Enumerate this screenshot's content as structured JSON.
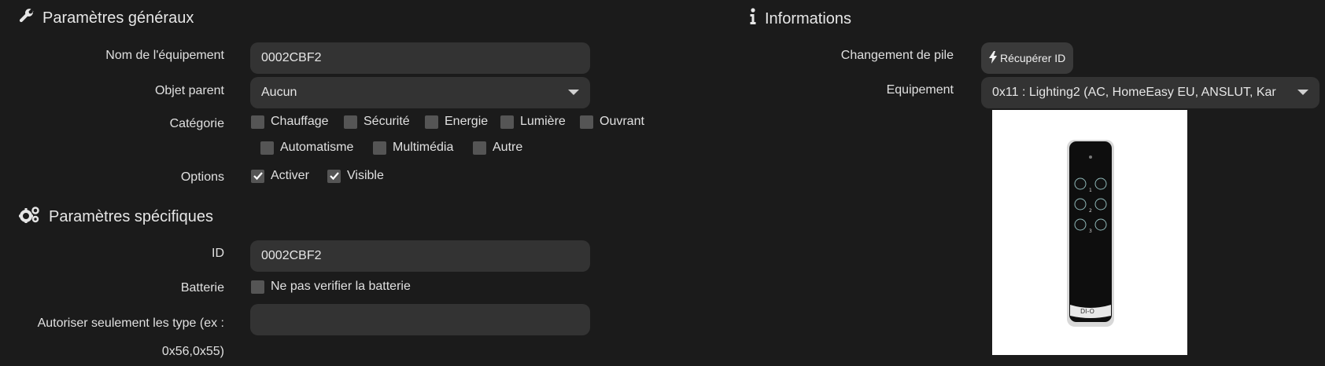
{
  "general": {
    "title": "Paramètres généraux",
    "name_label": "Nom de l'équipement",
    "name_value": "0002CBF2",
    "parent_label": "Objet parent",
    "parent_value": "Aucun",
    "category_label": "Catégorie",
    "categories": [
      "Chauffage",
      "Sécurité",
      "Energie",
      "Lumière",
      "Ouvrant",
      "Automatisme",
      "Multimédia",
      "Autre"
    ],
    "options_label": "Options",
    "options": [
      "Activer",
      "Visible"
    ]
  },
  "specific": {
    "title": "Paramètres spécifiques",
    "id_label": "ID",
    "id_value": "0002CBF2",
    "battery_label": "Batterie",
    "battery_checkbox": "Ne pas verifier la batterie",
    "types_label_line1": "Autoriser seulement les type (ex :",
    "types_label_line2": "0x56,0x55)",
    "types_value": ""
  },
  "info": {
    "title": "Informations",
    "battery_change_label": "Changement de pile",
    "recover_button": "Récupérer ID",
    "equipment_label": "Equipement",
    "equipment_value": "0x11 : Lighting2 (AC, HomeEasy EU, ANSLUT, Kar",
    "remote_brand": "DI-O",
    "button_numbers": [
      "1",
      "2",
      "3"
    ]
  }
}
